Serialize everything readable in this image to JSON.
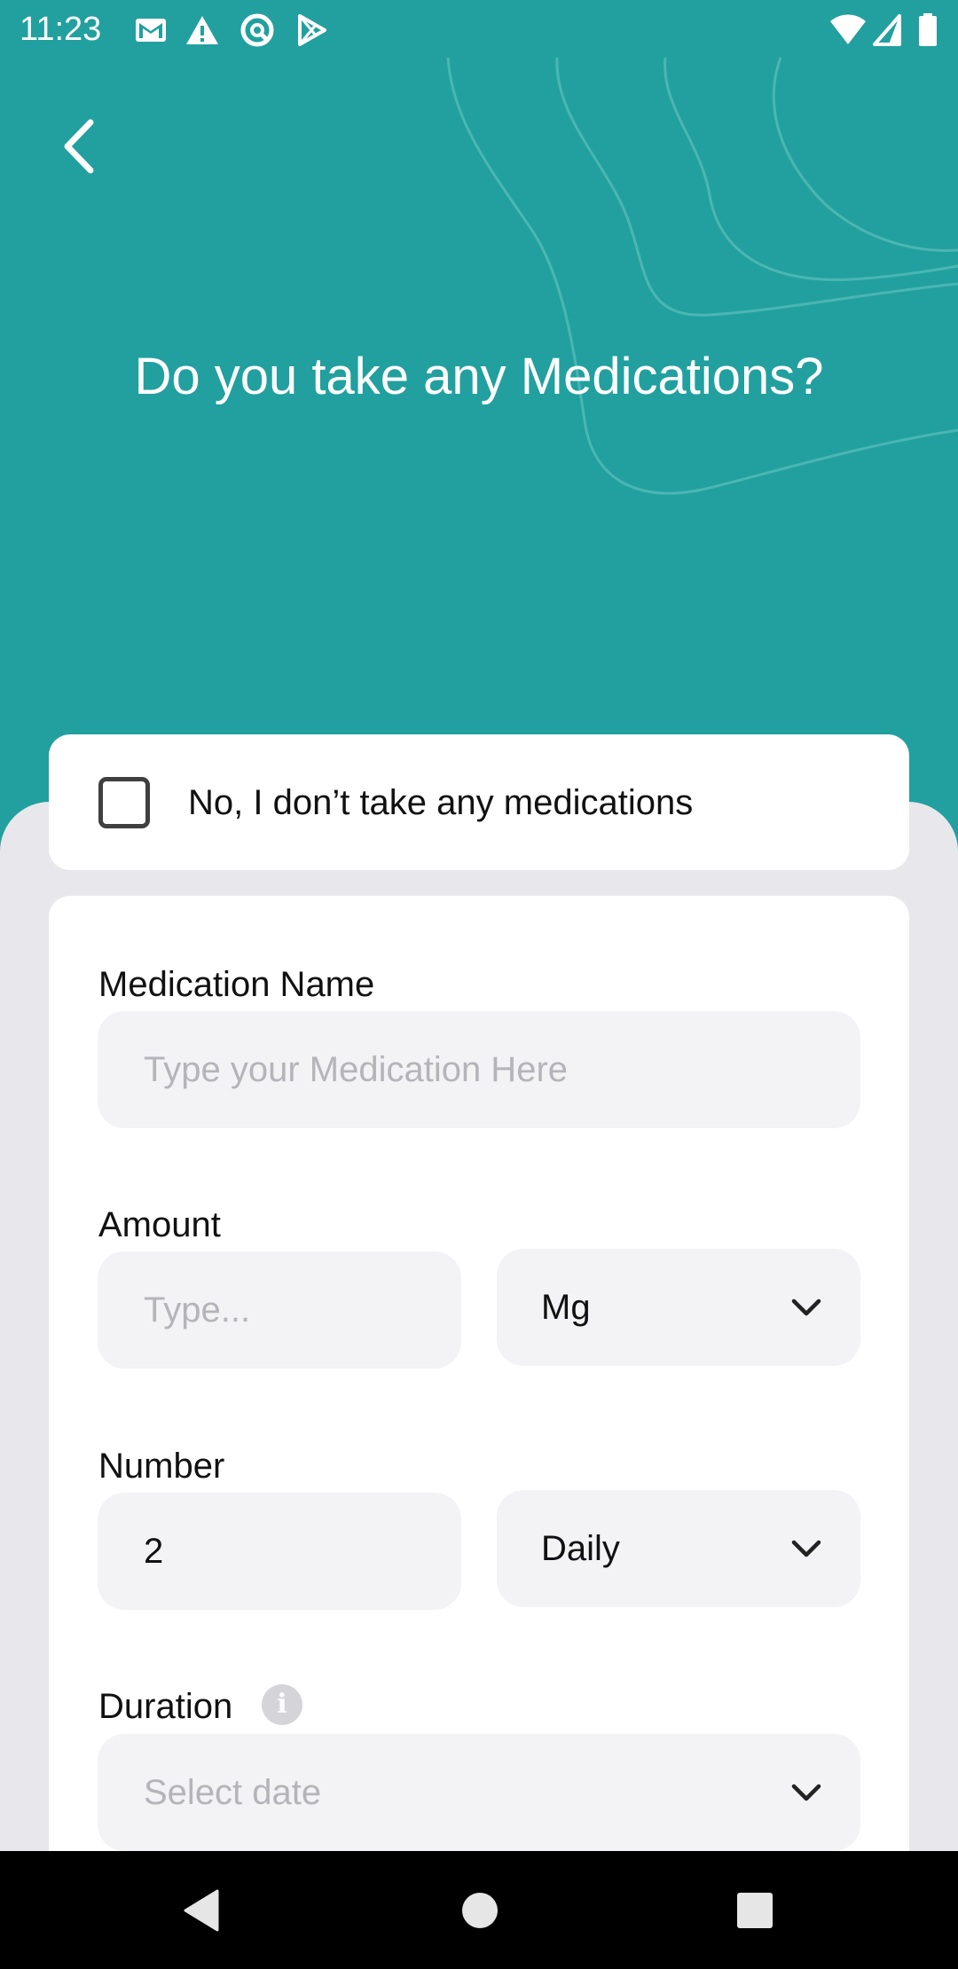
{
  "status_bar": {
    "time": "11:23",
    "left_icons": [
      "mail-icon",
      "warning-icon",
      "sync-icon",
      "play-store-icon"
    ],
    "right_icons": [
      "wifi-icon",
      "signal-icon",
      "battery-icon"
    ]
  },
  "header": {
    "title": "Do you take any Medications?",
    "background_color": "#21a09f"
  },
  "no_meds": {
    "label": "No, I don’t take any medications",
    "checked": false
  },
  "form": {
    "medication_name": {
      "label": "Medication Name",
      "placeholder": "Type your Medication Here",
      "value": ""
    },
    "amount": {
      "label": "Amount",
      "placeholder": "Type...",
      "value": "",
      "unit_selected": "Mg"
    },
    "number": {
      "label": "Number",
      "value": "2",
      "frequency_selected": "Daily"
    },
    "duration": {
      "label": "Duration",
      "info_icon": "i",
      "placeholder": "Select date"
    }
  },
  "nav_bar": {
    "buttons": [
      "back-triangle-icon",
      "home-circle-icon",
      "recents-square-icon"
    ]
  }
}
